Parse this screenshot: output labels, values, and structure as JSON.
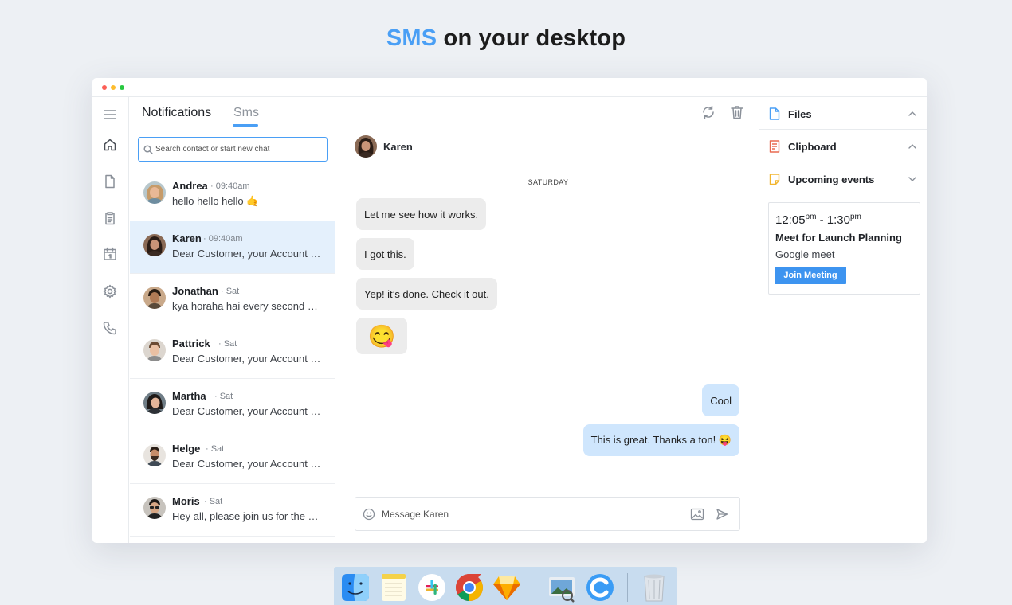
{
  "headline": {
    "accent": "SMS",
    "rest": " on your desktop"
  },
  "tabs": {
    "notifications": "Notifications",
    "sms": "Sms"
  },
  "search": {
    "placeholder": "Search contact or start new chat"
  },
  "contacts": [
    {
      "name": "Andrea",
      "time": "· 09:40am",
      "message": "hello hello hello 🤙"
    },
    {
      "name": "Karen",
      "time": "· 09:40am",
      "message": "Dear Customer, your Account Number..."
    },
    {
      "name": "Jonathan",
      "time": "· Sat",
      "message": "kya horaha hai every second day?"
    },
    {
      "name": "Pattrick",
      "time": "· Sat",
      "message": "Dear Customer, your Account Number..."
    },
    {
      "name": "Martha",
      "time": "· Sat",
      "message": "Dear Customer, your Account Number..."
    },
    {
      "name": "Helge",
      "time": "· Sat",
      "message": "Dear Customer, your Account Number..."
    },
    {
      "name": "Moris",
      "time": "· Sat",
      "message": "Hey all, please join us for the sale..."
    }
  ],
  "chat": {
    "contact_name": "Karen",
    "day_label": "SATURDAY",
    "messages": [
      {
        "dir": "in",
        "text": "Let me see how it works."
      },
      {
        "dir": "in",
        "text": "I got this."
      },
      {
        "dir": "in",
        "text": "Yep! it’s done. Check it out."
      },
      {
        "dir": "in",
        "text": "😋"
      },
      {
        "dir": "out",
        "text": "Cool"
      },
      {
        "dir": "out",
        "text": "This is great. Thanks a ton! 😝"
      }
    ],
    "composer_placeholder": "Message Karen"
  },
  "right_panel": {
    "files": "Files",
    "clipboard": "Clipboard",
    "upcoming_events": "Upcoming events",
    "event": {
      "start": "12:05",
      "start_suffix": "pm",
      "separator": " - ",
      "end": "1:30",
      "end_suffix": "pm",
      "title": "Meet for Launch Planning",
      "subtitle": "Google meet",
      "button": "Join Meeting"
    }
  },
  "dock_apps": [
    "finder-icon",
    "notes-icon",
    "slack-icon",
    "chrome-icon",
    "sketch-icon",
    "preview-icon",
    "sync-app-icon",
    "trash-icon"
  ],
  "colors": {
    "accent": "#4a9ff5",
    "selected_row": "#e4f0fc",
    "outgoing_bubble": "#cfe6fd",
    "incoming_bubble": "#ececec",
    "button": "#3d94f0"
  }
}
